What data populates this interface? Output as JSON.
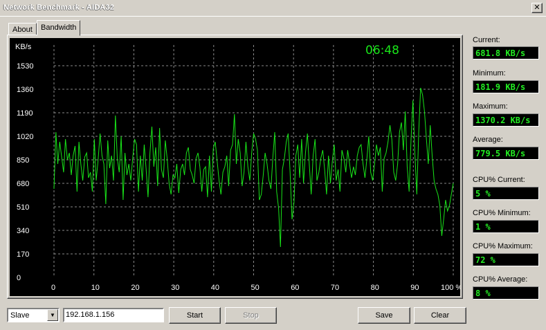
{
  "window": {
    "title": "Network Benchmark - AIDA32",
    "close_glyph": "✕"
  },
  "tabs": [
    {
      "label": "About",
      "active": false
    },
    {
      "label": "Bandwidth",
      "active": true
    }
  ],
  "graph": {
    "clock": "06:48",
    "unit_label": "KB/s",
    "line_color": "#19e619",
    "background": "#000000"
  },
  "stats": {
    "current_label": "Current:",
    "current_value": "681.8 KB/s",
    "minimum_label": "Minimum:",
    "minimum_value": "181.9 KB/s",
    "maximum_label": "Maximum:",
    "maximum_value": "1370.2 KB/s",
    "average_label": "Average:",
    "average_value": "779.5 KB/s",
    "cpu_current_label": "CPU% Current:",
    "cpu_current_value": "5 %",
    "cpu_minimum_label": "CPU% Minimum:",
    "cpu_minimum_value": "1 %",
    "cpu_maximum_label": "CPU% Maximum:",
    "cpu_maximum_value": "72 %",
    "cpu_average_label": "CPU% Average:",
    "cpu_average_value": "8 %"
  },
  "controls": {
    "mode_select": "Slave",
    "address": "192.168.1.156",
    "start_label": "Start",
    "stop_label": "Stop",
    "save_label": "Save",
    "clear_label": "Clear",
    "dropdown_icon": "triangle-down-icon"
  },
  "chart_data": {
    "type": "line",
    "ylabel": "KB/s",
    "ylim": [
      0,
      1530
    ],
    "yticks": [
      0,
      170,
      340,
      510,
      680,
      850,
      1020,
      1190,
      1360,
      1530
    ],
    "xlim": [
      0,
      100
    ],
    "xticks": [
      0,
      10,
      20,
      30,
      40,
      50,
      60,
      70,
      80,
      90,
      100
    ],
    "xtick_labels": [
      "0",
      "10",
      "20",
      "30",
      "40",
      "50",
      "60",
      "70",
      "80",
      "90",
      "100 %"
    ],
    "grid": true,
    "series": [
      {
        "values": [
          640,
          1050,
          820,
          980,
          870,
          760,
          1000,
          850,
          900,
          740,
          880,
          950,
          620,
          980,
          820,
          700,
          870,
          900,
          720,
          760,
          620,
          1000,
          700,
          850,
          1040,
          880,
          820,
          530,
          990,
          790,
          880,
          700,
          1170,
          860,
          760,
          1020,
          560,
          900,
          740,
          820,
          700,
          860,
          1000,
          960,
          620,
          880,
          700,
          960,
          780,
          580,
          900,
          1090,
          800,
          940,
          660,
          1080,
          780,
          720,
          990,
          850,
          680,
          600,
          740,
          720,
          820,
          610,
          780,
          820,
          740,
          900,
          940,
          780,
          740,
          680,
          860,
          900,
          800,
          620,
          780,
          800,
          580,
          880,
          620,
          930,
          980,
          840,
          700,
          600,
          760,
          800,
          880,
          660,
          920,
          960,
          1180,
          820,
          1000,
          900,
          660,
          760,
          980,
          800,
          700,
          900,
          1040,
          1000,
          920,
          560,
          600,
          740,
          900,
          820,
          700,
          640,
          860,
          1050,
          620,
          500,
          220,
          780,
          860,
          980,
          1040,
          760,
          420,
          540,
          880,
          960,
          720,
          1000,
          680,
          900,
          1040,
          820,
          600,
          880,
          1000,
          700,
          760,
          860,
          920,
          780,
          600,
          880,
          680,
          840,
          960,
          700,
          780,
          620,
          920,
          860,
          760,
          920,
          820,
          720,
          800,
          740,
          880,
          940,
          960,
          820,
          720,
          860,
          1020,
          760,
          700,
          820,
          960,
          880,
          940,
          620,
          860,
          900,
          980,
          1100,
          1000,
          760,
          700,
          820,
          1050,
          1120,
          920,
          1200,
          800,
          620,
          1000,
          1280,
          900,
          600,
          1050,
          1370,
          1320,
          1200,
          1000,
          820,
          1100,
          880,
          700,
          640,
          600,
          520,
          300,
          420,
          560,
          480,
          520,
          600,
          680
        ]
      }
    ]
  }
}
